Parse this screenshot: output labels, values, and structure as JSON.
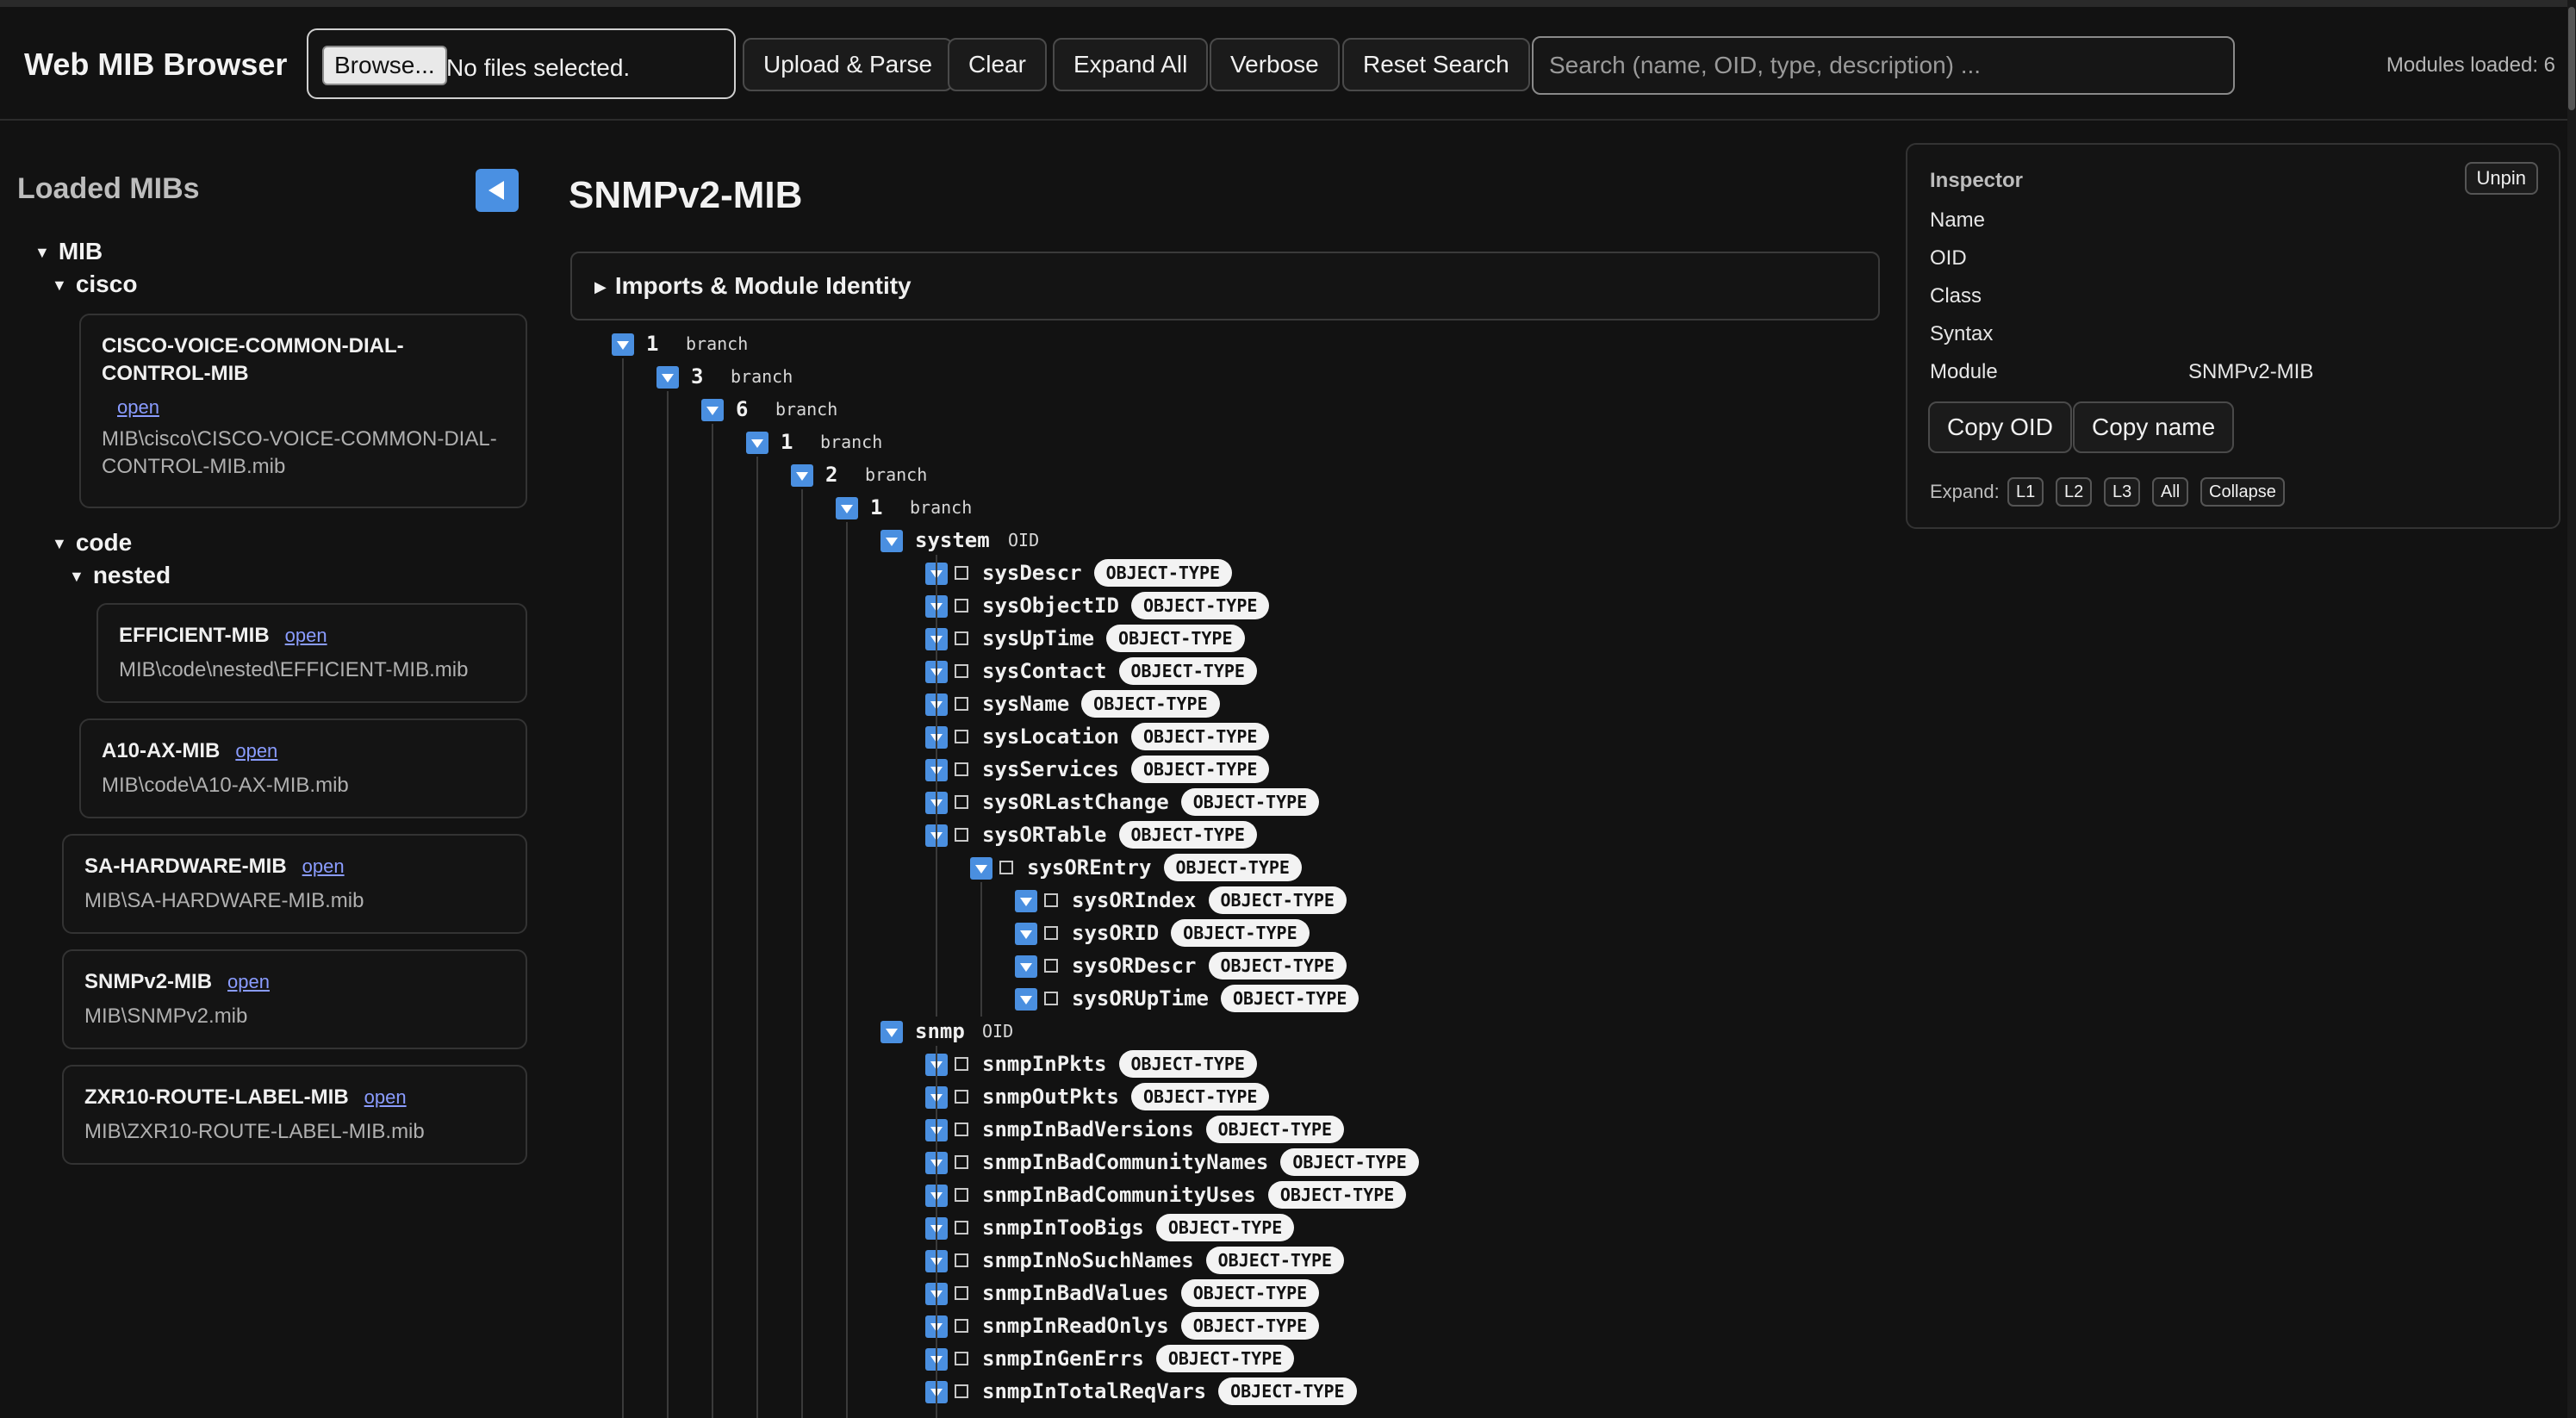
{
  "header": {
    "title": "Web MIB Browser",
    "browse_label": "Browse...",
    "file_status": "No files selected.",
    "buttons": {
      "upload": "Upload & Parse",
      "clear": "Clear",
      "expand_all": "Expand All",
      "verbose": "Verbose",
      "reset_search": "Reset Search"
    },
    "search_placeholder": "Search (name, OID, type, description) ...",
    "modules_loaded": "Modules loaded: 6"
  },
  "sidebar": {
    "title": "Loaded MIBs",
    "folders": {
      "mib": "MIB",
      "cisco": "cisco",
      "code": "code",
      "nested": "nested"
    },
    "open_label": "open",
    "mibs": [
      {
        "name": "CISCO-VOICE-COMMON-DIAL-CONTROL-MIB",
        "path": "MIB\\cisco\\CISCO-VOICE-COMMON-DIAL-CONTROL-MIB.mib"
      },
      {
        "name": "EFFICIENT-MIB",
        "path": "MIB\\code\\nested\\EFFICIENT-MIB.mib"
      },
      {
        "name": "A10-AX-MIB",
        "path": "MIB\\code\\A10-AX-MIB.mib"
      },
      {
        "name": "SA-HARDWARE-MIB",
        "path": "MIB\\SA-HARDWARE-MIB.mib"
      },
      {
        "name": "SNMPv2-MIB",
        "path": "MIB\\SNMPv2.mib"
      },
      {
        "name": "ZXR10-ROUTE-LABEL-MIB",
        "path": "MIB\\ZXR10-ROUTE-LABEL-MIB.mib"
      }
    ]
  },
  "main": {
    "module_title": "SNMPv2-MIB",
    "imports_label": "Imports & Module Identity",
    "branch_label": "branch",
    "oid_label": "OID",
    "type_label": "OBJECT-TYPE",
    "branches": [
      "1",
      "3",
      "6",
      "1",
      "2",
      "1"
    ],
    "system": {
      "name": "system",
      "children": [
        "sysDescr",
        "sysObjectID",
        "sysUpTime",
        "sysContact",
        "sysName",
        "sysLocation",
        "sysServices",
        "sysORLastChange",
        "sysORTable"
      ],
      "entry": "sysOREntry",
      "entry_children": [
        "sysORIndex",
        "sysORID",
        "sysORDescr",
        "sysORUpTime"
      ]
    },
    "snmp": {
      "name": "snmp",
      "children": [
        "snmpInPkts",
        "snmpOutPkts",
        "snmpInBadVersions",
        "snmpInBadCommunityNames",
        "snmpInBadCommunityUses",
        "snmpInTooBigs",
        "snmpInNoSuchNames",
        "snmpInBadValues",
        "snmpInReadOnlys",
        "snmpInGenErrs",
        "snmpInTotalReqVars"
      ]
    }
  },
  "inspector": {
    "title": "Inspector",
    "unpin_label": "Unpin",
    "fields": [
      {
        "label": "Name",
        "value": ""
      },
      {
        "label": "OID",
        "value": ""
      },
      {
        "label": "Class",
        "value": ""
      },
      {
        "label": "Syntax",
        "value": ""
      },
      {
        "label": "Module",
        "value": "SNMPv2-MIB"
      }
    ],
    "copy_oid": "Copy OID",
    "copy_name": "Copy name",
    "expand_label": "Expand:",
    "levels": [
      "L1",
      "L2",
      "L3",
      "All",
      "Collapse"
    ]
  },
  "colors": {
    "background": "#121212",
    "accent": "#4a8fe0",
    "link": "#8a9cff",
    "badge_bg": "#f3f3f3"
  }
}
